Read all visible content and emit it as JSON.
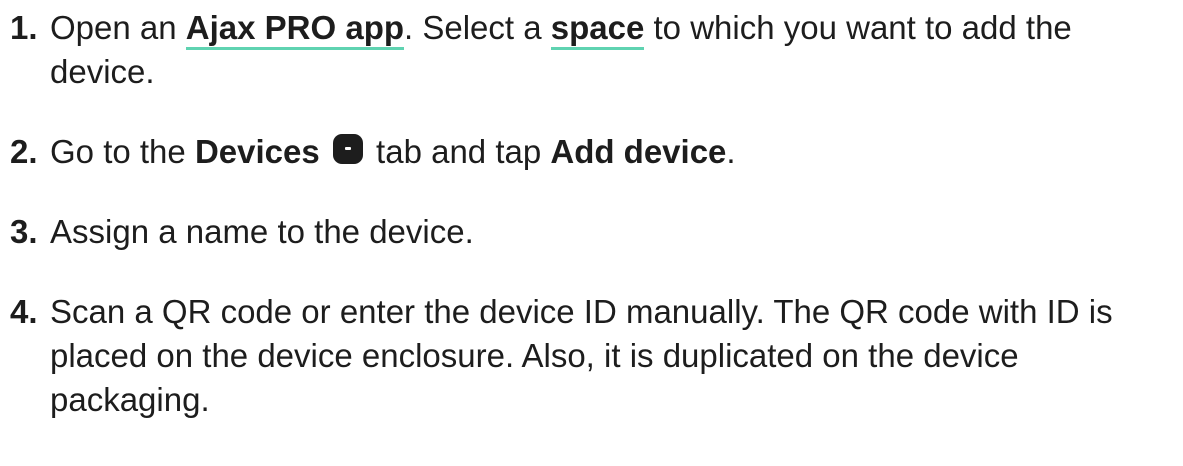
{
  "steps": [
    {
      "num": "1.",
      "t1": "Open an ",
      "link1": "Ajax PRO app",
      "t2": ". Select a ",
      "link2": "space",
      "t3": " to which you want to add the device."
    },
    {
      "num": "2.",
      "t1": "Go to the ",
      "b1": "Devices",
      "icon": "devices-tab-icon",
      "t2": " tab and tap ",
      "b2": "Add device",
      "t3": "."
    },
    {
      "num": "3.",
      "t1": "Assign a name to the device."
    },
    {
      "num": "4.",
      "t1": "Scan a QR code or enter the device ID manually. The QR code with ID is placed on the device enclosure. Also, it is duplicated on the device packaging."
    }
  ],
  "colors": {
    "text": "#1d1d1d",
    "link_underline": "#5fd3b1"
  }
}
